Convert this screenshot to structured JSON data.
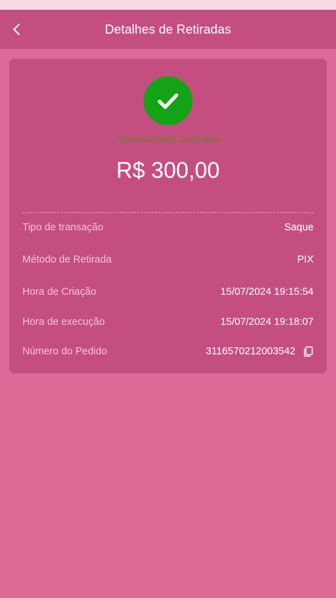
{
  "header": {
    "title": "Detalhes de Retiradas"
  },
  "status": {
    "message": "Retirada Bem Sucedida",
    "amount": "R$ 300,00"
  },
  "details": [
    {
      "label": "Tipo de transação",
      "value": "Saque"
    },
    {
      "label": "Método de Retirada",
      "value": "PIX"
    },
    {
      "label": "Hora de Criação",
      "value": "15/07/2024 19:15:54"
    },
    {
      "label": "Hora de execução",
      "value": "15/07/2024 19:18:07"
    },
    {
      "label": "Número do Pedido",
      "value": "3116570212003542"
    }
  ],
  "icons": {
    "back": "chevron-left-icon",
    "success": "check-icon",
    "copy": "copy-icon"
  },
  "colors": {
    "background": "#dc6996",
    "header": "#c54e80",
    "card": "#c54e80",
    "success_green": "#14a316",
    "status_text": "#6f7d2a"
  }
}
